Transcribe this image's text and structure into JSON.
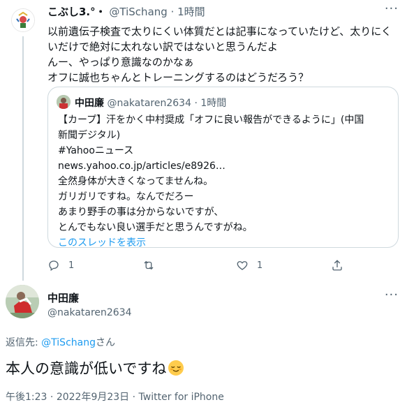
{
  "quoting_tweet": {
    "display_name": "こぶし3.°・",
    "handle": "@TiSchang",
    "separator": "·",
    "time": "1時間",
    "lines": [
      "以前遺伝子検査で太りにくい体質だとは記事になっていたけど、太りにく",
      "いだけで絶対に太れない訳ではないと思うんだよ",
      "んー、やっぱり意識なのかなぁ",
      "オフに誠也ちゃんとトレーニングするのはどうだろう？"
    ]
  },
  "quoted_tweet": {
    "display_name": "中田廉",
    "handle": "@nakataren2634",
    "separator": "·",
    "time": "1時間",
    "lines": [
      "【カープ】汗をかく中村奨成「オフに良い報告ができるように」(中国",
      "新聞デジタル)",
      "#Yahooニュース",
      "news.yahoo.co.jp/articles/e8926…",
      "全然身体が大きくなってませんね。",
      "ガリガリですね。なんでだろー",
      "あまり野手の事は分からないですが、",
      "とんでもない良い選手だと思うんですがね。"
    ],
    "show_thread": "このスレッドを表示"
  },
  "actions": {
    "reply_count": "1",
    "retweet_count": "",
    "like_count": "1"
  },
  "reply_tweet": {
    "display_name": "中田廉",
    "handle": "@nakataren2634",
    "reply_prefix": "返信先: ",
    "reply_to": "@TiSchang",
    "reply_suffix": "さん",
    "text": "本人の意識が低いですね",
    "emoji": "relieved-face-emoji",
    "time": "午後1:23",
    "date": "2022年9月23日",
    "source": "Twitter for iPhone",
    "meta_separator": " · "
  },
  "more_label": "···",
  "colors": {
    "link": "#1d9bf0",
    "muted": "#536471",
    "text": "#0f1419",
    "border": "#cfd9de"
  }
}
